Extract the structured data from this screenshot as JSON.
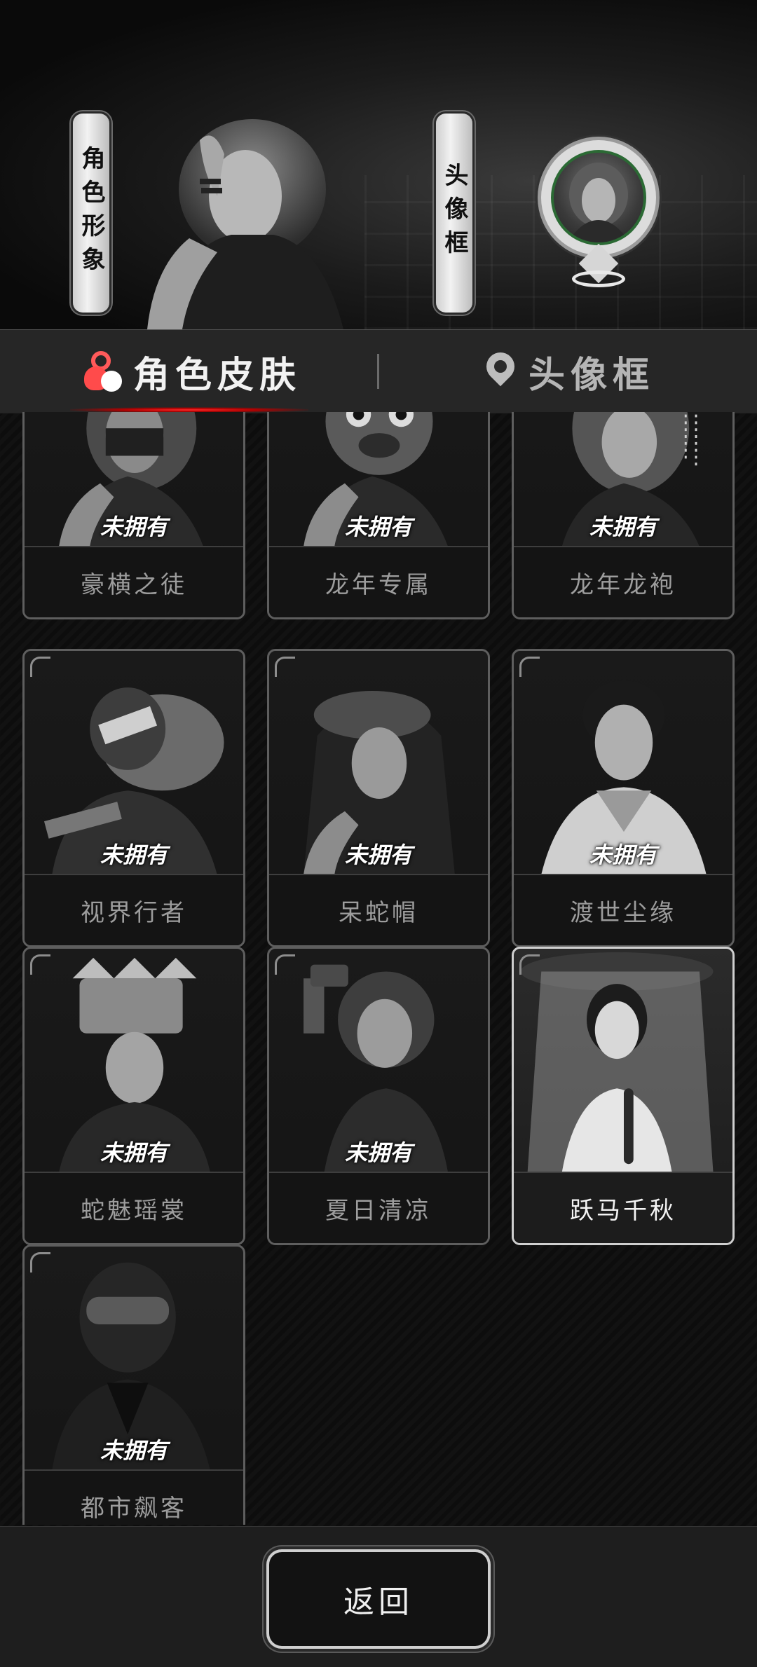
{
  "header": {
    "character_banner_label": "角色形象",
    "frame_banner_label": "头像框"
  },
  "tabs": [
    {
      "label": "角色皮肤",
      "active": true,
      "icon": "skin-icon"
    },
    {
      "label": "头像框",
      "active": false,
      "icon": "avatar-pin-icon"
    }
  ],
  "skins": [
    {
      "name": "豪横之徒",
      "status": "未拥有",
      "owned": false
    },
    {
      "name": "龙年专属",
      "status": "未拥有",
      "owned": false
    },
    {
      "name": "龙年龙袍",
      "status": "未拥有",
      "owned": false
    },
    {
      "name": "视界行者",
      "status": "未拥有",
      "owned": false
    },
    {
      "name": "呆蛇帽",
      "status": "未拥有",
      "owned": false
    },
    {
      "name": "渡世尘缘",
      "status": "未拥有",
      "owned": false
    },
    {
      "name": "蛇魅瑶裳",
      "status": "未拥有",
      "owned": false
    },
    {
      "name": "夏日清凉",
      "status": "未拥有",
      "owned": false
    },
    {
      "name": "跃马千秋",
      "status": "",
      "owned": true
    },
    {
      "name": "都市飙客",
      "status": "未拥有",
      "owned": false
    }
  ],
  "footer": {
    "back_label": "返回"
  },
  "colors": {
    "accent_red": "#ff2a2a",
    "avatar_ring_green": "#2b6a34"
  }
}
